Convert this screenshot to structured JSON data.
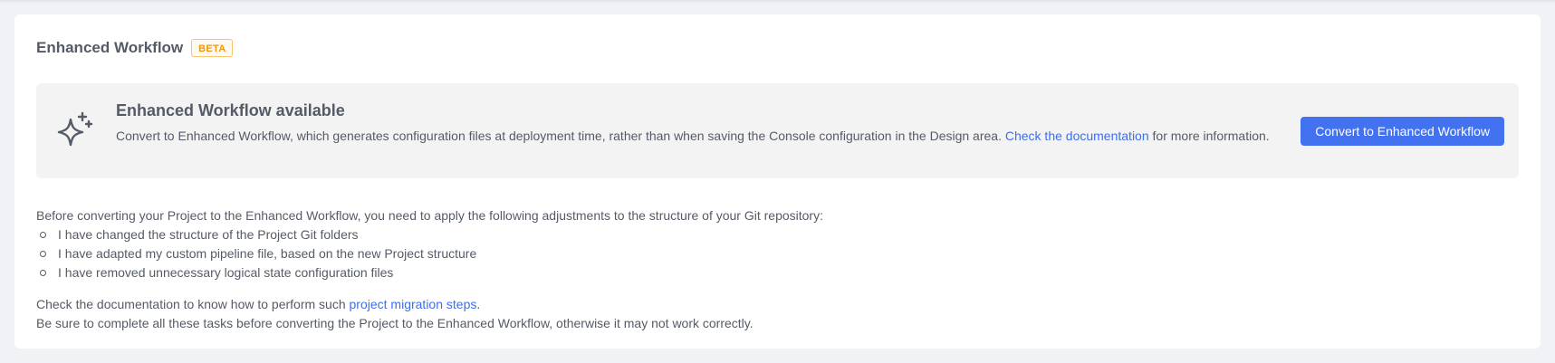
{
  "header": {
    "title": "Enhanced Workflow",
    "badge": "BETA"
  },
  "banner": {
    "icon": "sparkles-icon",
    "title": "Enhanced Workflow available",
    "description_before": "Convert to Enhanced Workflow, which generates configuration files at deployment time, rather than when saving the Console configuration in the Design area. ",
    "doc_link": "Check the documentation",
    "description_after": " for more information.",
    "button_label": "Convert to Enhanced Workflow"
  },
  "instructions": {
    "intro": "Before converting your Project to the Enhanced Workflow, you need to apply the following adjustments to the structure of your Git repository:",
    "items": [
      "I have changed the structure of the Project Git folders",
      "I have adapted my custom pipeline file, based on the new Project structure",
      "I have removed unnecessary logical state configuration files"
    ],
    "doc_text_before": "Check the documentation to know how to perform such ",
    "migration_link": "project migration steps",
    "doc_text_after": ".",
    "warning": "Be sure to complete all these tasks before converting the Project to the Enhanced Workflow, otherwise it may not work correctly."
  },
  "colors": {
    "accent": "#4372f0",
    "link": "#3e6ee8",
    "badge": "#f2960f",
    "banner_bg": "#f3f3f4",
    "page_bg": "#f1f2f5"
  }
}
